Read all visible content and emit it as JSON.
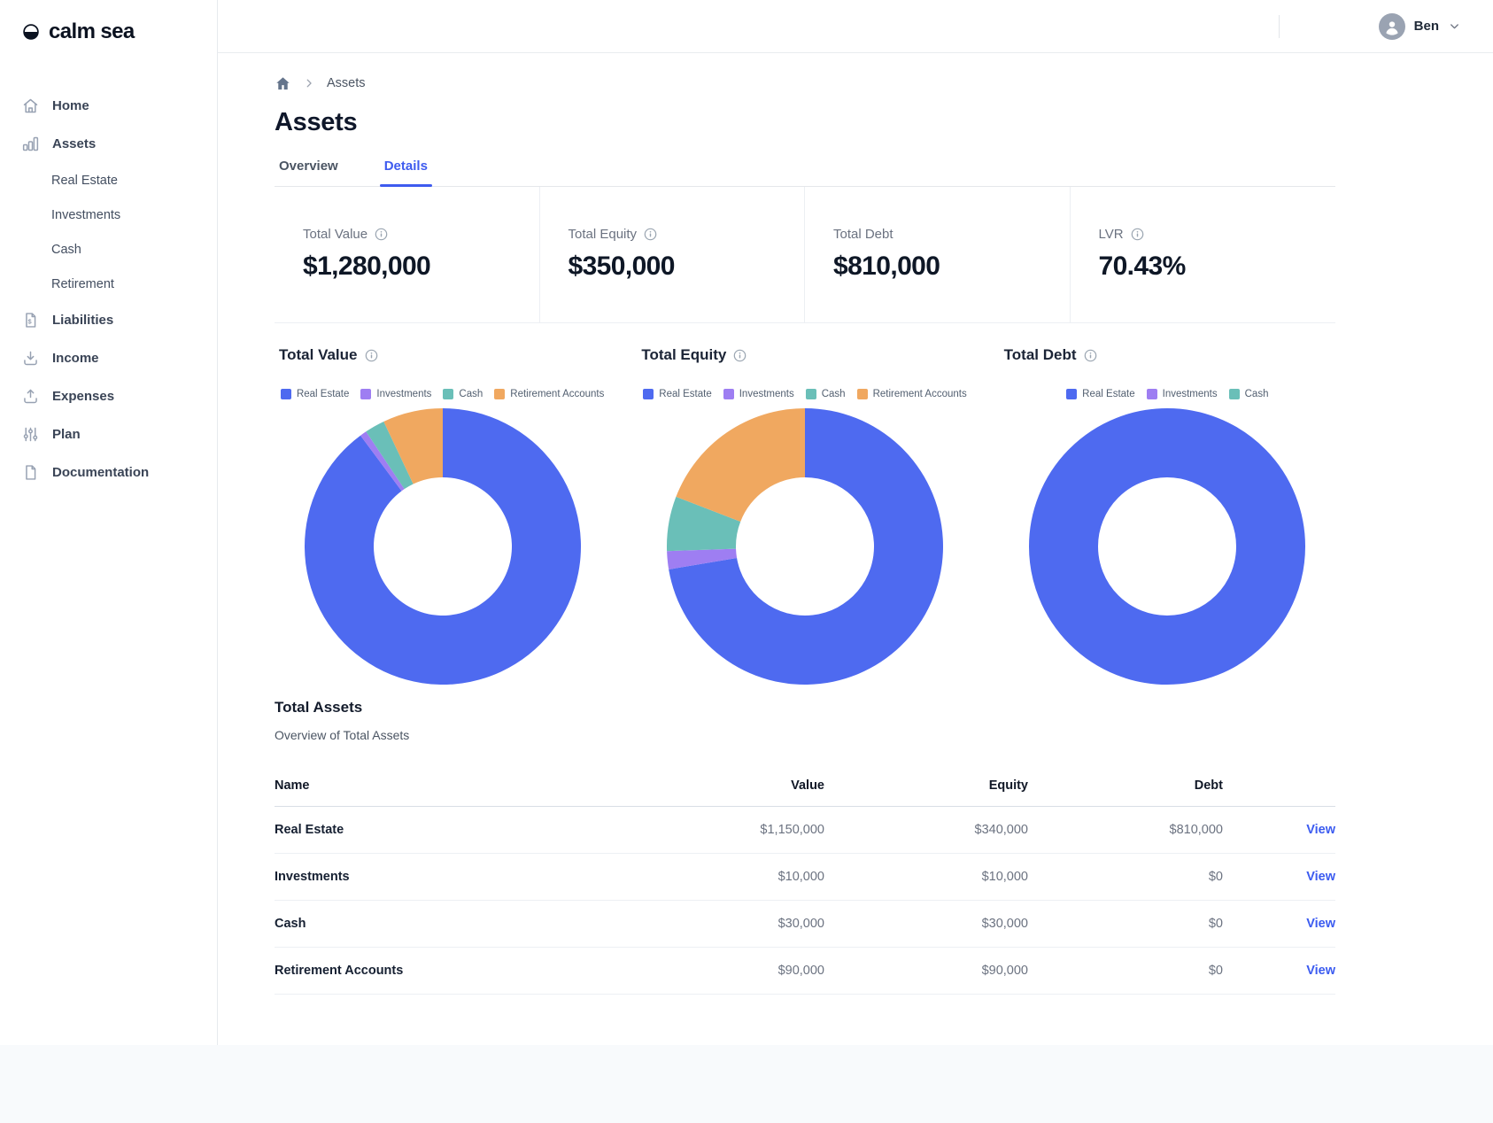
{
  "brand": {
    "name": "calm sea"
  },
  "topbar": {
    "user_name": "Ben"
  },
  "breadcrumb": {
    "current": "Assets"
  },
  "page": {
    "title": "Assets"
  },
  "tabs": [
    {
      "label": "Overview",
      "active": false
    },
    {
      "label": "Details",
      "active": true
    }
  ],
  "sidebar": {
    "items": [
      {
        "label": "Home",
        "icon": "home-icon"
      },
      {
        "label": "Assets",
        "icon": "assets-chart-icon",
        "children": [
          {
            "label": "Real Estate"
          },
          {
            "label": "Investments"
          },
          {
            "label": "Cash"
          },
          {
            "label": "Retirement"
          }
        ]
      },
      {
        "label": "Liabilities",
        "icon": "liabilities-icon"
      },
      {
        "label": "Income",
        "icon": "income-icon"
      },
      {
        "label": "Expenses",
        "icon": "expenses-icon"
      },
      {
        "label": "Plan",
        "icon": "plan-sliders-icon"
      },
      {
        "label": "Documentation",
        "icon": "document-icon"
      }
    ]
  },
  "stats": [
    {
      "label": "Total Value",
      "value": "$1,280,000",
      "has_info": true
    },
    {
      "label": "Total Equity",
      "value": "$350,000",
      "has_info": true
    },
    {
      "label": "Total Debt",
      "value": "$810,000",
      "has_info": false
    },
    {
      "label": "LVR",
      "value": "70.43%",
      "has_info": true
    }
  ],
  "colors": {
    "accent": "#3e5bef",
    "link": "#3b5bf0",
    "real_estate": "#4e6af0",
    "investments": "#9e7ef2",
    "cash": "#6abfb8",
    "retirement_accounts": "#f0a860"
  },
  "chart_data": [
    {
      "type": "pie",
      "variant": "donut",
      "title": "Total Value",
      "has_info": true,
      "categories": [
        "Real Estate",
        "Investments",
        "Cash",
        "Retirement Accounts"
      ],
      "values": [
        1150000,
        10000,
        30000,
        90000
      ],
      "colors": [
        "#4e6af0",
        "#9e7ef2",
        "#6abfb8",
        "#f0a860"
      ],
      "legend_position": "top"
    },
    {
      "type": "pie",
      "variant": "donut",
      "title": "Total Equity",
      "has_info": true,
      "categories": [
        "Real Estate",
        "Investments",
        "Cash",
        "Retirement Accounts"
      ],
      "values": [
        340000,
        10000,
        30000,
        90000
      ],
      "colors": [
        "#4e6af0",
        "#9e7ef2",
        "#6abfb8",
        "#f0a860"
      ],
      "legend_position": "top"
    },
    {
      "type": "pie",
      "variant": "donut",
      "title": "Total Debt",
      "has_info": true,
      "categories": [
        "Real Estate",
        "Investments",
        "Cash"
      ],
      "values": [
        810000,
        0,
        0
      ],
      "colors": [
        "#4e6af0",
        "#9e7ef2",
        "#6abfb8"
      ],
      "legend_position": "top"
    }
  ],
  "table": {
    "title": "Total Assets",
    "subtitle": "Overview of Total Assets",
    "columns": [
      "Name",
      "Value",
      "Equity",
      "Debt"
    ],
    "action_label": "View",
    "rows": [
      {
        "name": "Real Estate",
        "value": "$1,150,000",
        "equity": "$340,000",
        "debt": "$810,000"
      },
      {
        "name": "Investments",
        "value": "$10,000",
        "equity": "$10,000",
        "debt": "$0"
      },
      {
        "name": "Cash",
        "value": "$30,000",
        "equity": "$30,000",
        "debt": "$0"
      },
      {
        "name": "Retirement Accounts",
        "value": "$90,000",
        "equity": "$90,000",
        "debt": "$0"
      }
    ]
  }
}
